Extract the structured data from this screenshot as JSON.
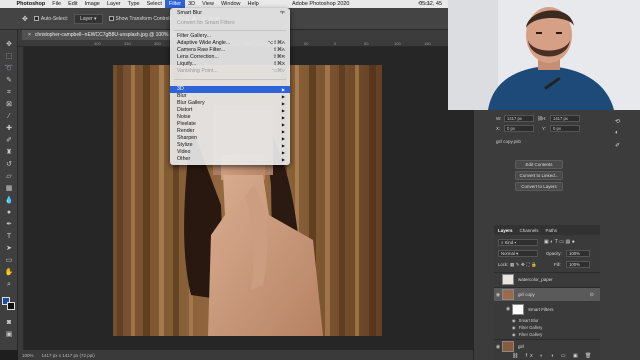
{
  "menubar": {
    "app": "Photoshop",
    "items": [
      "File",
      "Edit",
      "Image",
      "Layer",
      "Type",
      "Select",
      "Filter",
      "3D",
      "View",
      "Window",
      "Help"
    ],
    "active": "Filter",
    "window_title": "Adobe Photoshop 2020",
    "clock": "05:12, 45"
  },
  "optbar": {
    "auto_select": "Auto-Select:",
    "layer": "Layer",
    "show_transform": "Show Transform Controls",
    "mode_3d": "3D Mode:"
  },
  "document": {
    "tab_title": "christopher-campbell--nEWCC7gB8U-unsplash.jpg @ 100% (girl c",
    "close": "×"
  },
  "ruler_ticks": [
    "400",
    "350",
    "300",
    "250",
    "200",
    "150",
    "100",
    "50",
    "0",
    "50",
    "100",
    "150",
    "200",
    "250",
    "300"
  ],
  "status": {
    "zoom": "100%",
    "size": "1417 px x 1417 px (72 ppi)"
  },
  "filter_menu": {
    "items": [
      {
        "label": "Smart Blur",
        "shortcut": "^F",
        "state": "normal"
      },
      {
        "label": "Convert for Smart Filters",
        "shortcut": "",
        "state": "disabled"
      },
      {
        "sep": true
      },
      {
        "label": "Filter Gallery...",
        "shortcut": "",
        "state": "normal"
      },
      {
        "label": "Adaptive Wide Angle...",
        "shortcut": "⌥⇧⌘A",
        "state": "normal"
      },
      {
        "label": "Camera Raw Filter...",
        "shortcut": "⇧⌘A",
        "state": "normal"
      },
      {
        "label": "Lens Correction...",
        "shortcut": "⇧⌘R",
        "state": "normal"
      },
      {
        "label": "Liquify...",
        "shortcut": "⇧⌘X",
        "state": "normal"
      },
      {
        "label": "Vanishing Point...",
        "shortcut": "⌥⌘V",
        "state": "disabled"
      },
      {
        "sep": true
      },
      {
        "label": "3D",
        "arrow": true,
        "state": "highlight"
      },
      {
        "label": "Blur",
        "arrow": true,
        "state": "normal"
      },
      {
        "label": "Blur Gallery",
        "arrow": true,
        "state": "normal"
      },
      {
        "label": "Distort",
        "arrow": true,
        "state": "normal"
      },
      {
        "label": "Noise",
        "arrow": true,
        "state": "normal"
      },
      {
        "label": "Pixelate",
        "arrow": true,
        "state": "normal"
      },
      {
        "label": "Render",
        "arrow": true,
        "state": "normal"
      },
      {
        "label": "Sharpen",
        "arrow": true,
        "state": "normal"
      },
      {
        "label": "Stylize",
        "arrow": true,
        "state": "normal"
      },
      {
        "label": "Video",
        "arrow": true,
        "state": "normal"
      },
      {
        "label": "Other",
        "arrow": true,
        "state": "normal"
      }
    ]
  },
  "properties": {
    "w": "1417 px",
    "h": "1417 px",
    "x": "0 px",
    "y": "0 px",
    "linked_path": "girl copy.psb",
    "edit_contents": "Edit Contents",
    "convert_linked": "Convert to Linked...",
    "convert_layers": "Convert to Layers"
  },
  "layers": {
    "tabs": [
      "Layers",
      "Channels",
      "Paths"
    ],
    "kind": "Kind",
    "blend": "Normal",
    "opacity_label": "Opacity:",
    "opacity": "100%",
    "lock_label": "Lock:",
    "fill_label": "Fill:",
    "fill": "100%",
    "rows": [
      {
        "name": "watercolor_paper"
      },
      {
        "name": "girl copy"
      }
    ],
    "smart_filters": "Smart Filters",
    "filters": [
      "Smart Blur",
      "Filter Gallery",
      "Filter Gallery"
    ],
    "bottom_layer": "girl"
  },
  "colors": {
    "accent": "#2d63d8",
    "fg": "#1c4d9a",
    "bg": "#111111"
  }
}
